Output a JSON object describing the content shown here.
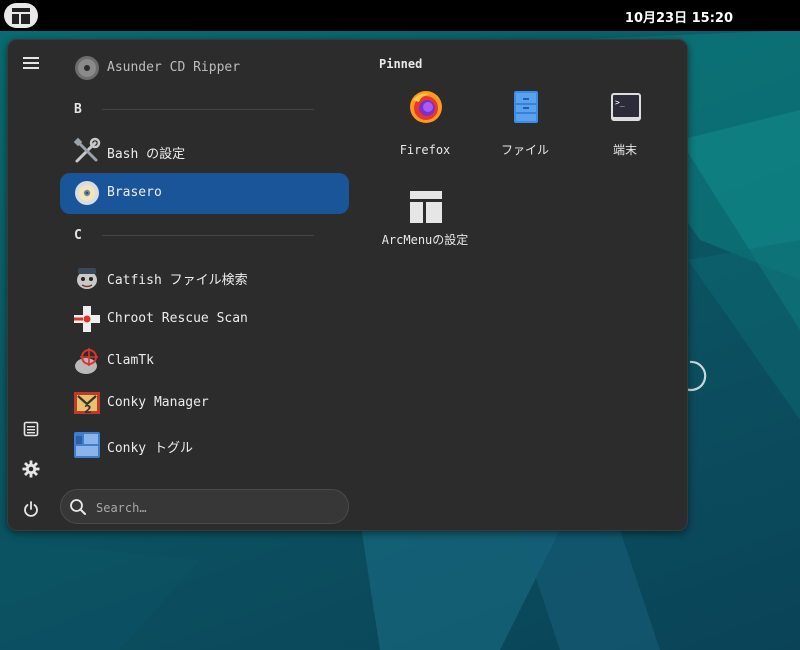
{
  "topbar": {
    "activities_icon": "arcmenu-layout-icon",
    "clock": "10月23日  15:20"
  },
  "sidebar": {
    "buttons": [
      {
        "name": "hamburger-icon"
      },
      {
        "name": "document-icon"
      },
      {
        "name": "gear-icon"
      },
      {
        "name": "power-icon"
      }
    ]
  },
  "applist": {
    "items": [
      {
        "label": "Asunder CD Ripper",
        "icon": "cd-icon"
      },
      {
        "label": "Bash の設定",
        "icon": "tools-icon"
      },
      {
        "label": "Brasero",
        "icon": "disc-burner-icon",
        "selected": true
      },
      {
        "label": "Catfish ファイル検索",
        "icon": "catfish-icon"
      },
      {
        "label": "Chroot Rescue Scan",
        "icon": "rescue-icon"
      },
      {
        "label": "ClamTk",
        "icon": "clamtk-icon"
      },
      {
        "label": "Conky Manager",
        "icon": "conky-manager-icon"
      },
      {
        "label": "Conky トグル",
        "icon": "conky-toggle-icon"
      }
    ],
    "sections": [
      "B",
      "C"
    ]
  },
  "search": {
    "placeholder": "Search…"
  },
  "pinned": {
    "title": "Pinned",
    "tiles": [
      {
        "label": "Firefox",
        "icon": "firefox-icon"
      },
      {
        "label": "ファイル",
        "icon": "files-icon"
      },
      {
        "label": "端末",
        "icon": "terminal-icon"
      },
      {
        "label": "ArcMenuの設定",
        "icon": "arcmenu-settings-icon"
      }
    ]
  },
  "colors": {
    "menu_bg": "#2c2c2c",
    "selected": "#1a5499",
    "topbar": "#000000"
  }
}
